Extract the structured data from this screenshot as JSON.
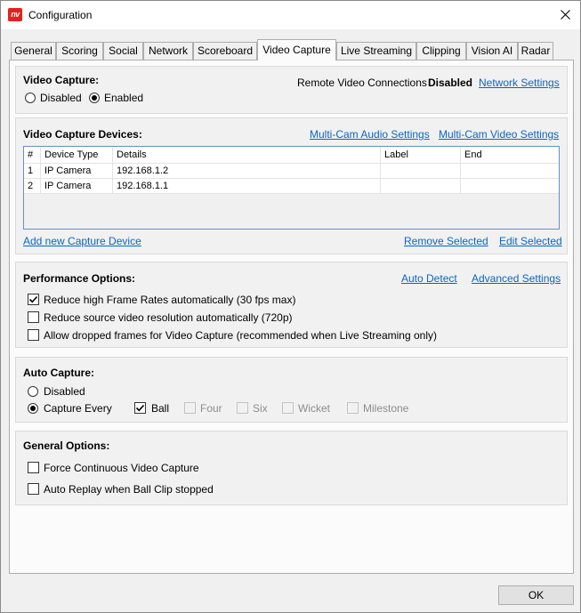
{
  "window": {
    "title": "Configuration",
    "app_icon_text": "nv"
  },
  "tabs": [
    "General",
    "Scoring",
    "Social",
    "Network",
    "Scoreboard",
    "Video Capture",
    "Live Streaming",
    "Clipping",
    "Vision AI",
    "Radar"
  ],
  "active_tab": "Video Capture",
  "video_capture": {
    "heading": "Video Capture:",
    "options": {
      "disabled": "Disabled",
      "enabled": "Enabled"
    },
    "selected": "Enabled",
    "remote_label": "Remote Video Connections",
    "remote_status": "Disabled",
    "network_settings_link": "Network Settings"
  },
  "devices": {
    "heading": "Video Capture Devices:",
    "multicam_audio_link": "Multi-Cam Audio Settings",
    "multicam_video_link": "Multi-Cam Video Settings",
    "columns": [
      "#",
      "Device Type",
      "Details",
      "Label",
      "End"
    ],
    "rows": [
      {
        "num": "1",
        "device_type": "IP Camera",
        "details": "192.168.1.2",
        "label": "",
        "end": ""
      },
      {
        "num": "2",
        "device_type": "IP Camera",
        "details": "192.168.1.1",
        "label": "",
        "end": ""
      }
    ],
    "add_link": "Add new Capture Device",
    "remove_link": "Remove Selected",
    "edit_link": "Edit Selected"
  },
  "performance": {
    "heading": "Performance Options:",
    "auto_detect_link": "Auto Detect",
    "advanced_link": "Advanced Settings",
    "options": [
      {
        "label": "Reduce high Frame Rates automatically (30 fps max)",
        "checked": true
      },
      {
        "label": "Reduce source video resolution automatically (720p)",
        "checked": false
      },
      {
        "label": "Allow dropped frames for Video Capture (recommended when Live Streaming only)",
        "checked": false
      }
    ]
  },
  "auto_capture": {
    "heading": "Auto Capture:",
    "disabled_label": "Disabled",
    "capture_every_label": "Capture Every",
    "selected": "Capture Every",
    "events": [
      {
        "label": "Ball",
        "checked": true,
        "enabled": true
      },
      {
        "label": "Four",
        "checked": false,
        "enabled": false
      },
      {
        "label": "Six",
        "checked": false,
        "enabled": false
      },
      {
        "label": "Wicket",
        "checked": false,
        "enabled": false
      },
      {
        "label": "Milestone",
        "checked": false,
        "enabled": false
      }
    ]
  },
  "general_options": {
    "heading": "General Options:",
    "options": [
      {
        "label": "Force Continuous Video Capture",
        "checked": false
      },
      {
        "label": "Auto Replay when Ball Clip stopped",
        "checked": false
      }
    ]
  },
  "ok_button": "OK",
  "colors": {
    "link": "#0a66c2",
    "accent_red": "#e2221f",
    "table_border": "#6a8fc5"
  }
}
